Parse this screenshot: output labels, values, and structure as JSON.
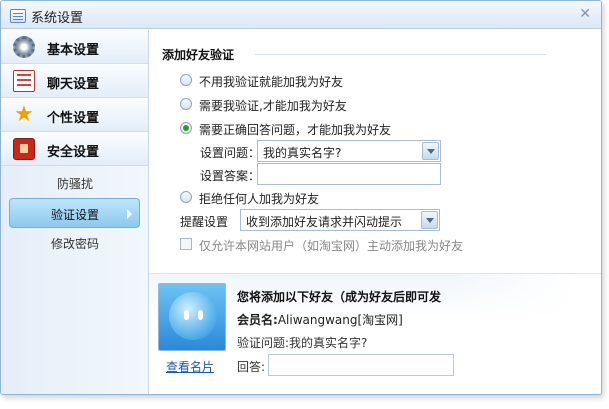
{
  "window": {
    "title": "系统设置"
  },
  "sidebar": {
    "categories": [
      {
        "label": "基本设置",
        "icon": "gear-icon"
      },
      {
        "label": "聊天设置",
        "icon": "chat-icon"
      },
      {
        "label": "个性设置",
        "icon": "star-icon"
      },
      {
        "label": "安全设置",
        "icon": "lock-icon"
      }
    ],
    "subitems": [
      {
        "label": "防骚扰",
        "active": false
      },
      {
        "label": "验证设置",
        "active": true
      },
      {
        "label": "修改密码",
        "active": false
      }
    ]
  },
  "main": {
    "section_title": "添加好友验证",
    "options": {
      "no_verify": "不用我验证就能加我为好友",
      "need_verify": "需要我验证,才能加我为好友",
      "need_answer": "需要正确回答问题，才能加我为好友",
      "refuse_all": "拒绝任何人加我为好友"
    },
    "selected_option": "need_answer",
    "question_label": "设置问题：",
    "question_value": "我的真实名字?",
    "answer_label": "设置答案：",
    "answer_value": "",
    "remind_label": "提醒设置",
    "remind_value": "收到添加好友请求并闪动提示",
    "site_users_label": "仅允许本网站用户（如淘宝网）主动添加我为好友"
  },
  "preview": {
    "title": "您将添加以下好友（成为好友后即可发",
    "member_label": "会员名:",
    "member_value": "Aliwangwang[淘宝网]",
    "question_text": "验证问题:我的真实名字?",
    "answer_label": "回答:",
    "view_card_link": "查看名片"
  },
  "colors": {
    "accent": "#8cc9ee",
    "link": "#1a58a8",
    "radio_checked": "#2f9a2f"
  }
}
